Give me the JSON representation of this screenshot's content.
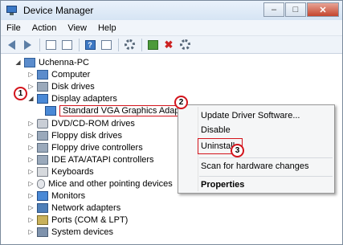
{
  "window": {
    "title": "Device Manager"
  },
  "window_buttons": {
    "minimize": "–",
    "maximize": "□",
    "close": "✕"
  },
  "menu": [
    "File",
    "Action",
    "View",
    "Help"
  ],
  "toolbar": {
    "buttons": [
      "back-icon",
      "forward-icon",
      "show-hide-tree-icon",
      "properties-icon",
      "help-icon",
      "properties-sheet-icon",
      "scan-hardware-icon",
      "update-driver-icon",
      "uninstall-icon",
      "disable-icon"
    ],
    "help_glyph": "?"
  },
  "tree": {
    "root": "Uchenna-PC",
    "categories": [
      "Computer",
      "Disk drives",
      "Display adapters",
      "DVD/CD-ROM drives",
      "Floppy disk drives",
      "Floppy drive controllers",
      "IDE ATA/ATAPI controllers",
      "Keyboards",
      "Mice and other pointing devices",
      "Monitors",
      "Network adapters",
      "Ports (COM & LPT)",
      "System devices"
    ],
    "display_child": "Standard VGA Graphics Adapter"
  },
  "context_menu": {
    "items": [
      "Update Driver Software...",
      "Disable",
      "Uninstall",
      "Scan for hardware changes",
      "Properties"
    ]
  },
  "steps": [
    "1",
    "2",
    "3"
  ],
  "colors": {
    "highlight": "#d3141c",
    "titlebar": "#d6e4f4"
  }
}
